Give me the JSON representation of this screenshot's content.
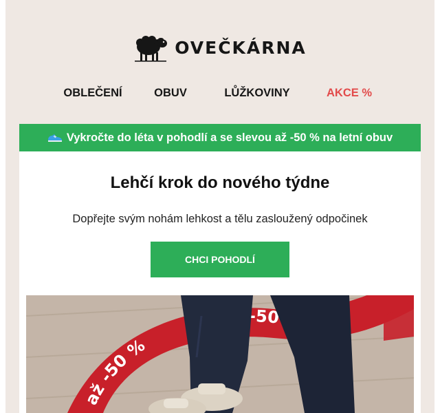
{
  "brand": {
    "name": "OVEČKÁRNA",
    "logo_icon": "sheep-icon"
  },
  "nav": {
    "items": [
      {
        "label": "OBLEČENÍ"
      },
      {
        "label": "OBUV"
      },
      {
        "label": "LŮŽKOVINY"
      },
      {
        "label": "AKCE %"
      }
    ]
  },
  "banner": {
    "icon": "sneaker-icon",
    "text": "Vykročte do léta v pohodlí a se slevou až -50 % na letní obuv"
  },
  "content": {
    "headline": "Lehčí krok do nového týdne",
    "subline": "Dopřejte svým nohám lehkost a tělu zasloužený odpočinek",
    "cta_label": "CHCI POHODLÍ"
  },
  "hero": {
    "ring_text": "až -50 %",
    "colors": {
      "ring": "#c8202a",
      "jeans": "#1d2436",
      "sandal": "#dcd3c4"
    }
  },
  "colors": {
    "accent_green": "#2dae58",
    "sale_red": "#e24b4b",
    "background": "#efe8e3"
  }
}
